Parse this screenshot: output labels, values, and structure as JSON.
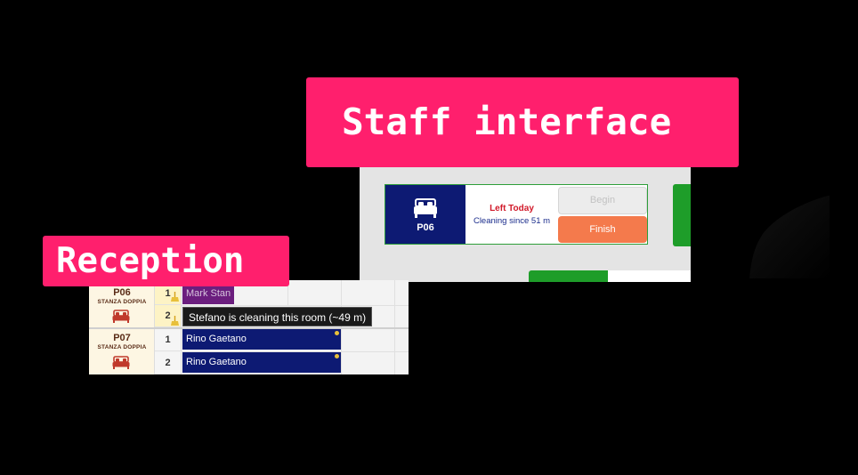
{
  "labels": {
    "staff": "Staff interface",
    "reception": "Reception"
  },
  "staff": {
    "room_code": "P06",
    "status_title": "Left Today",
    "status_detail": "Cleaning since 51 m",
    "begin_label": "Begin",
    "finish_label": "Finish",
    "bottom_bar_fill_fraction": 0.49
  },
  "reception": {
    "rooms": [
      {
        "code": "P06",
        "type": "STANZA DOPPIA",
        "beds": [
          {
            "number": "1",
            "booking": "Mark Stan",
            "color": "purple",
            "cleaning_icon": true
          },
          {
            "number": "2",
            "booking": "",
            "color": "",
            "cleaning_icon": true
          }
        ]
      },
      {
        "code": "P07",
        "type": "STANZA DOPPIA",
        "beds": [
          {
            "number": "1",
            "booking": "Rino Gaetano",
            "color": "blue",
            "cleaning_icon": false
          },
          {
            "number": "2",
            "booking": "Rino Gaetano",
            "color": "blue",
            "cleaning_icon": false
          }
        ]
      }
    ],
    "tooltip": "Stefano is cleaning this room (~49 m)"
  },
  "colors": {
    "accent_label": "#ff1f6d",
    "room_blue": "#0d1a73",
    "finish_orange": "#f47a4c",
    "status_green": "#1e9d29",
    "left_today_red": "#d11a2a"
  },
  "icons": [
    "bed-icon",
    "broom-icon"
  ]
}
